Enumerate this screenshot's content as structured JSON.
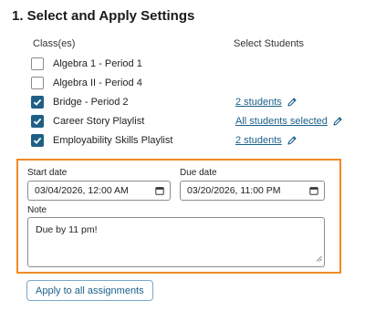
{
  "section": {
    "title": "1. Select and Apply Settings"
  },
  "columns": {
    "classes": "Class(es)",
    "students": "Select Students"
  },
  "classes": [
    {
      "label": "Algebra 1 - Period 1",
      "checked": false,
      "students": ""
    },
    {
      "label": "Algebra II - Period 4",
      "checked": false,
      "students": ""
    },
    {
      "label": "Bridge - Period 2",
      "checked": true,
      "students": "2 students"
    },
    {
      "label": "Career Story Playlist",
      "checked": true,
      "students": "All students selected"
    },
    {
      "label": "Employability Skills Playlist",
      "checked": true,
      "students": "2 students"
    }
  ],
  "settings": {
    "start_date_label": "Start date",
    "start_date_value": "03/04/2026, 12:00 AM",
    "due_date_label": "Due date",
    "due_date_value": "03/20/2026, 11:00 PM",
    "note_label": "Note",
    "note_value": "Due by 11 pm!"
  },
  "apply_button": "Apply to all assignments",
  "colors": {
    "accent": "#1f5f86",
    "link": "#1a5f8a",
    "highlight_border": "#f08a24"
  },
  "icons": {
    "edit": "pencil-icon",
    "calendar": "calendar-icon",
    "check": "check-icon"
  }
}
